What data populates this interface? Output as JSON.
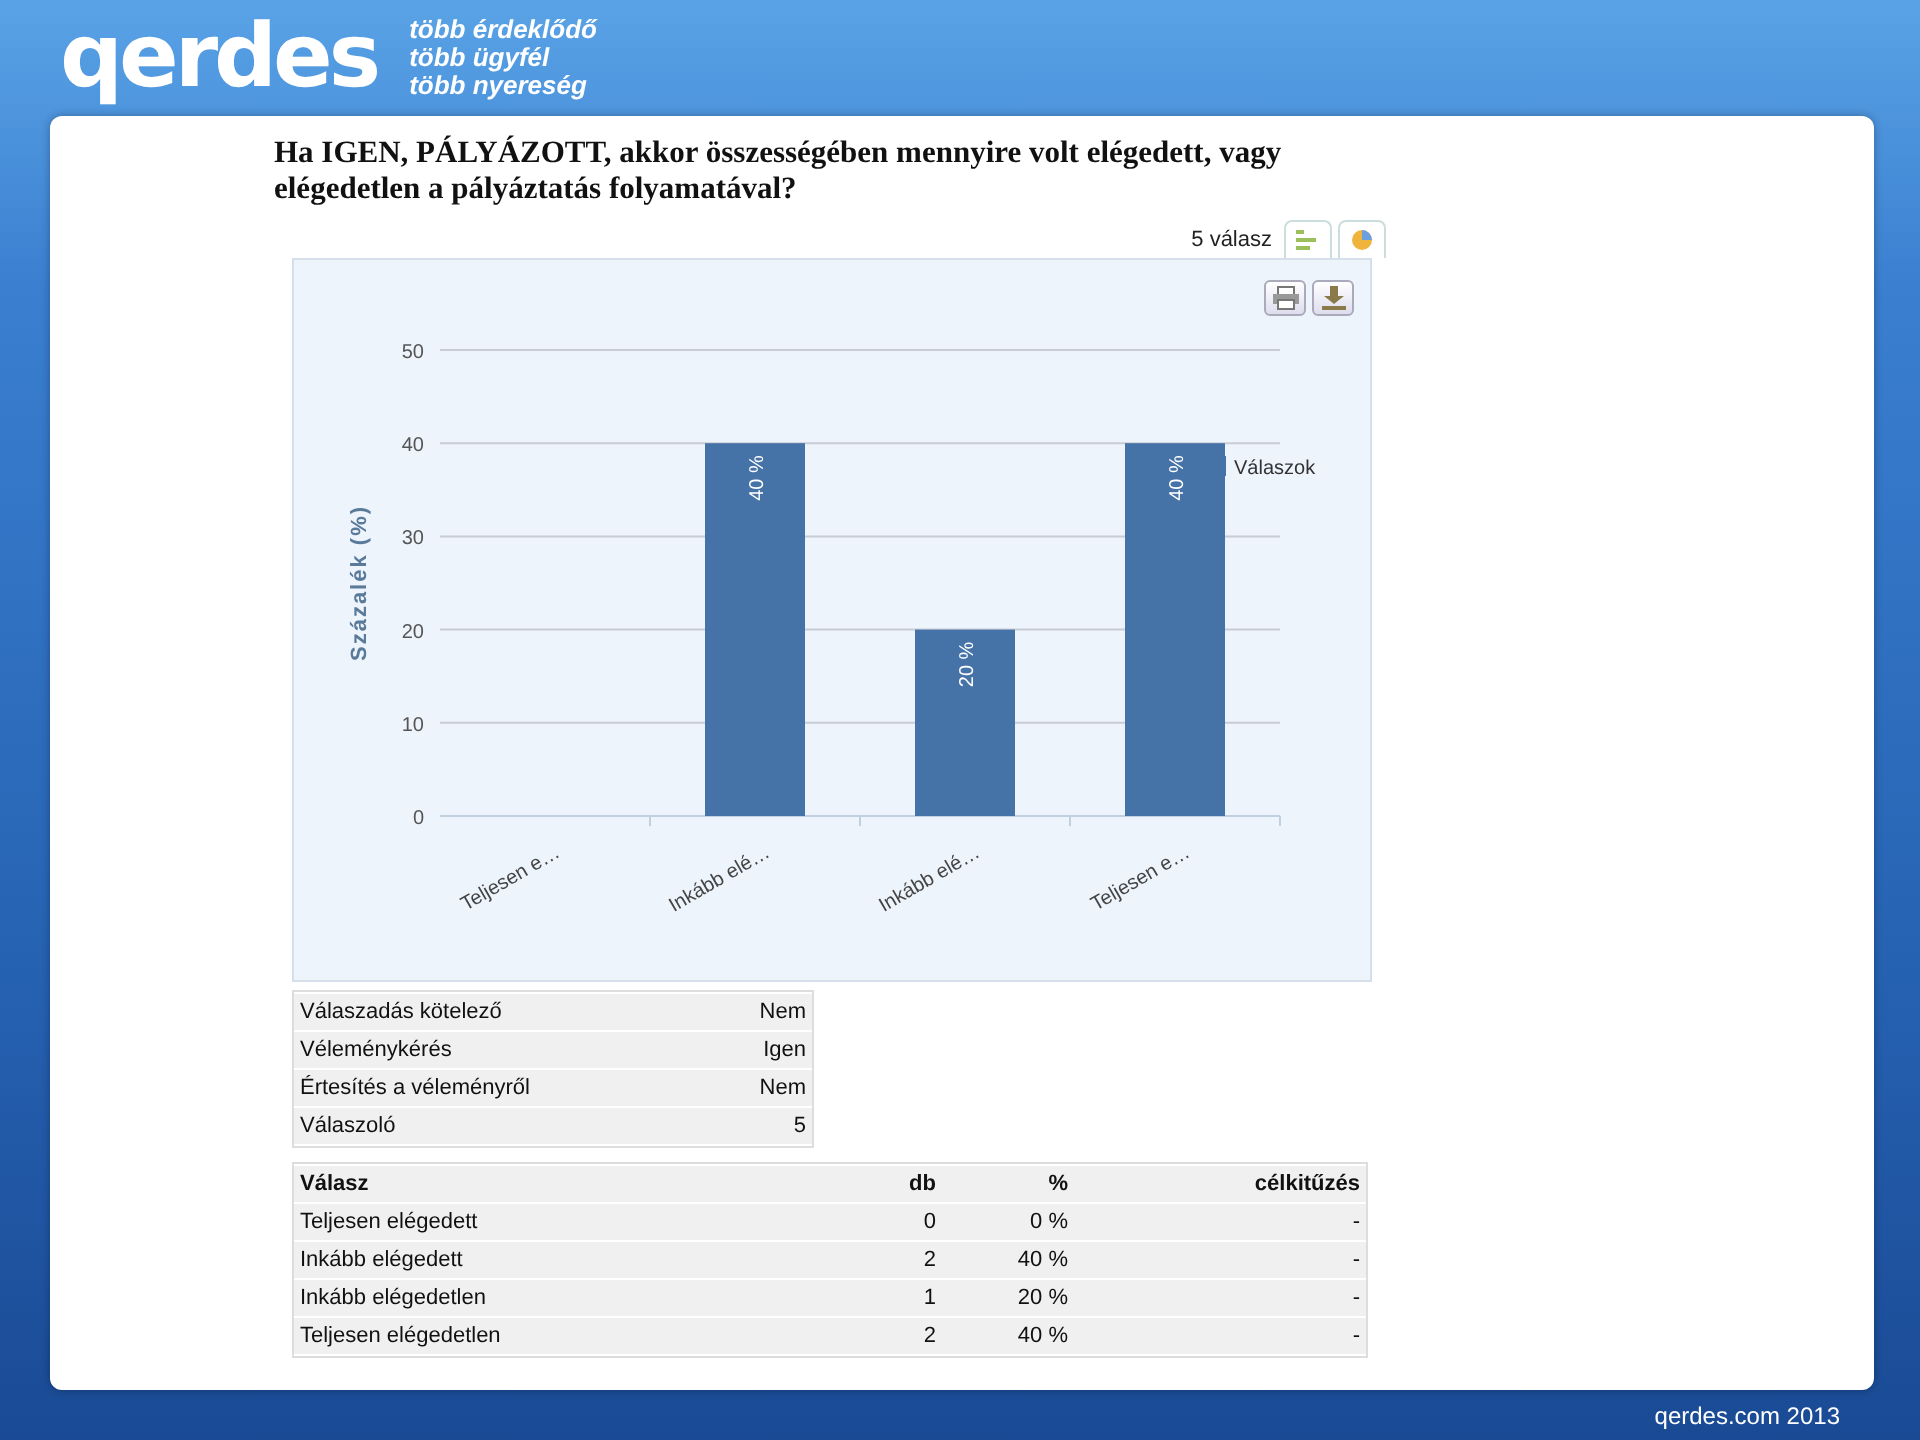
{
  "header": {
    "logo": "qerdes",
    "taglines": [
      "több érdeklődő",
      "több ügyfél",
      "több nyereség"
    ]
  },
  "question": "Ha IGEN, PÁLYÁZOTT, akkor összességében mennyire volt elégedett, vagy elégedetlen a pályáztatás folyamatával?",
  "response_count": "5 válasz",
  "chart": {
    "chart_data": {
      "type": "bar",
      "ylabel": "Százalék (%)",
      "categories": [
        "Teljesen e…",
        "Inkább elé…",
        "Inkább elé…",
        "Teljesen e…"
      ],
      "series": [
        {
          "name": "Válaszok",
          "color": "#4572a7",
          "values": [
            0,
            40,
            20,
            40
          ]
        }
      ],
      "ylim": [
        0,
        50
      ],
      "grid": true,
      "yticks": [
        0,
        10,
        20,
        30,
        40,
        50
      ],
      "value_labels": [
        null,
        "40 %",
        "20 %",
        "40 %"
      ]
    }
  },
  "settings": [
    {
      "label": "Válaszadás kötelező",
      "value": "Nem"
    },
    {
      "label": "Véleménykérés",
      "value": "Igen"
    },
    {
      "label": "Értesítés a véleményről",
      "value": "Nem"
    },
    {
      "label": "Válaszoló",
      "value": "5"
    }
  ],
  "answers": {
    "columns": [
      "Válasz",
      "db",
      "%",
      "célkitűzés"
    ],
    "rows": [
      [
        "Teljesen elégedett",
        "0",
        "0 %",
        "-"
      ],
      [
        "Inkább elégedett",
        "2",
        "40 %",
        "-"
      ],
      [
        "Inkább elégedetlen",
        "1",
        "20 %",
        "-"
      ],
      [
        "Teljesen elégedetlen",
        "2",
        "40 %",
        "-"
      ]
    ]
  },
  "footer": "qerdes.com 2013"
}
